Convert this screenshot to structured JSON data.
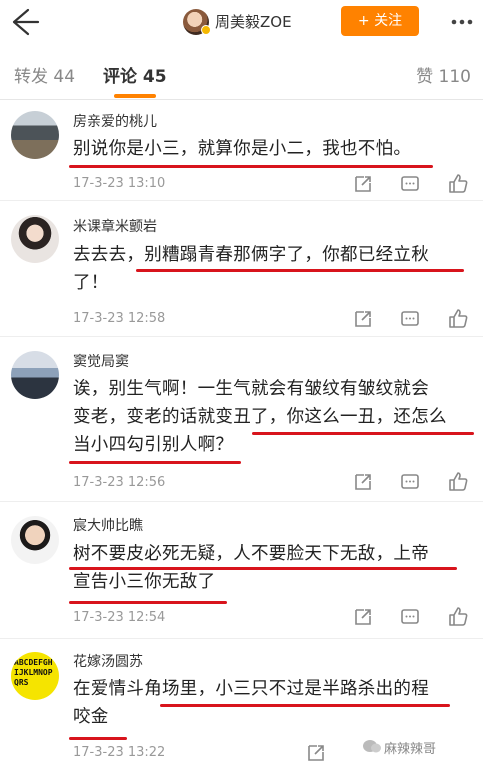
{
  "header": {
    "title": "周美毅ZOE",
    "follow_label": "+ 关注"
  },
  "tabs": {
    "repost": "转发 44",
    "comment": "评论 45",
    "like": "赞 110"
  },
  "comments": [
    {
      "user": "房亲爱的桃儿",
      "line1": "别说你是小三，就算你是小二，我也不怕。",
      "line2": "",
      "line3": "",
      "time": "17-3-23 13:10"
    },
    {
      "user": "米课章米颤岩",
      "line1": "去去去，别糟蹋青春那俩字了，你都已经立秋",
      "line2": "了！",
      "line3": "",
      "time": "17-3-23 12:58"
    },
    {
      "user": "窦觉局窦",
      "line1": "诶，别生气啊！一生气就会有皱纹有皱纹就会",
      "line2": "变老，变老的话就变丑了，你这么一丑，还怎么",
      "line3": "当小四勾引别人啊？",
      "time": "17-3-23 12:56"
    },
    {
      "user": "宸大帅比瞧",
      "line1": "树不要皮必死无疑，人不要脸天下无敌，上帝",
      "line2": "宣告小三你无敌了",
      "line3": "",
      "time": "17-3-23 12:54"
    },
    {
      "user": "花嫁汤圆苏",
      "line1": "在爱情斗角场里，小三只不过是半路杀出的程",
      "line2": "咬金",
      "line3": "",
      "time": "17-3-23 13:22"
    }
  ],
  "avatar5_text": "ABCDEFGHIJKLMNOPQRS",
  "watermark": "麻辣辣哥",
  "colors": {
    "accent": "#ff8200",
    "annotation_red": "#d8141c"
  }
}
